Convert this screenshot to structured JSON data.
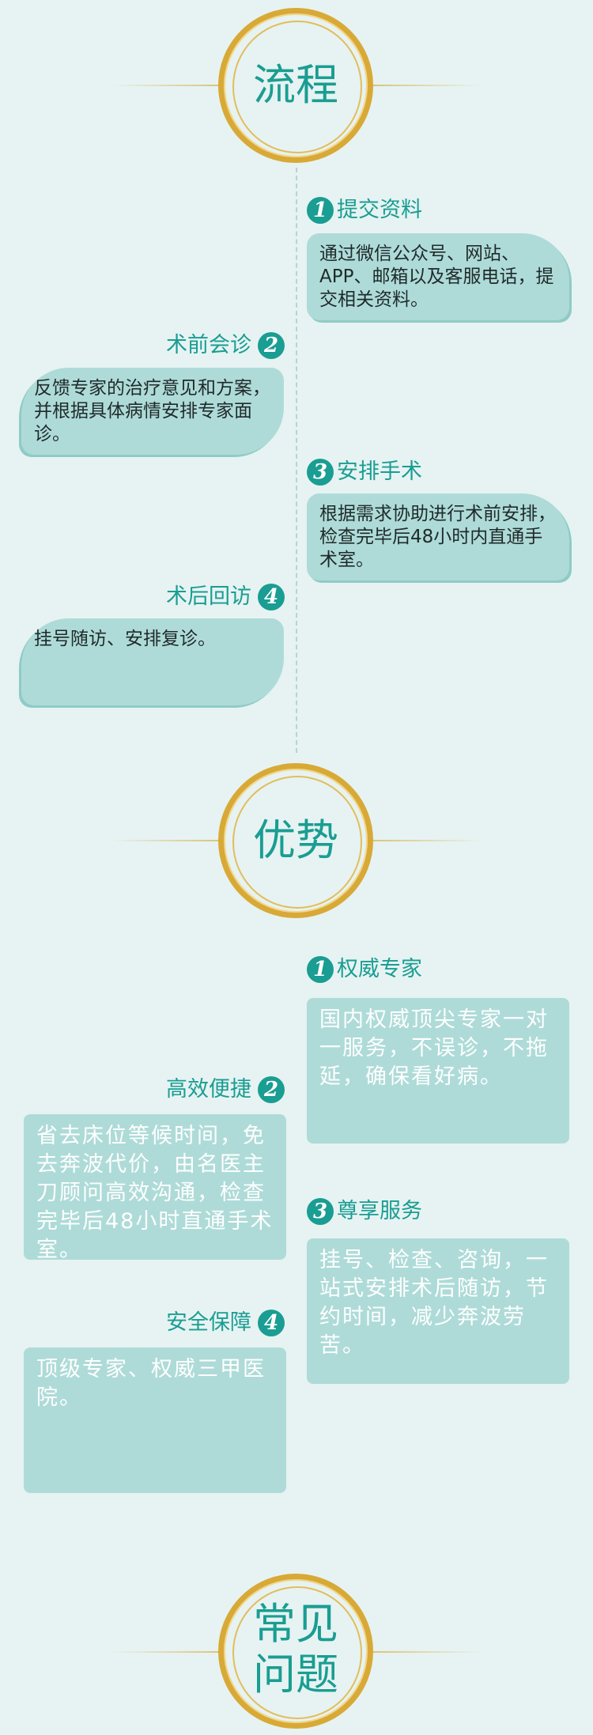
{
  "sections": {
    "process": {
      "title": "流程",
      "steps": [
        {
          "num": "1",
          "title": "提交资料",
          "text": "通过微信公众号、网站、APP、邮箱以及客服电话，提交相关资料。"
        },
        {
          "num": "2",
          "title": "术前会诊",
          "text": "反馈专家的治疗意见和方案，并根据具体病情安排专家面诊。"
        },
        {
          "num": "3",
          "title": "安排手术",
          "text": "根据需求协助进行术前安排，检查完毕后48小时内直通手术室。"
        },
        {
          "num": "4",
          "title": "术后回访",
          "text": "挂号随访、安排复诊。"
        }
      ]
    },
    "advantages": {
      "title": "优势",
      "items": [
        {
          "num": "1",
          "title": "权威专家",
          "text": "国内权威顶尖专家一对一服务，不误诊，不拖延，确保看好病。"
        },
        {
          "num": "2",
          "title": "高效便捷",
          "text": "省去床位等候时间，免去奔波代价，由名医主刀顾问高效沟通，检查完毕后48小时直通手术室。"
        },
        {
          "num": "3",
          "title": "尊享服务",
          "text": "挂号、检查、咨询，一站式安排术后随访，节约时间，减少奔波劳苦。"
        },
        {
          "num": "4",
          "title": "安全保障",
          "text": "顶级专家、权威三甲医院。"
        }
      ]
    },
    "faq": {
      "title_line1": "常见",
      "title_line2": "问题"
    }
  },
  "colors": {
    "background": "#e6f3f2",
    "accent_teal": "#1a9d92",
    "box_fill": "#aedbd8",
    "gold_ring": "#d8a936"
  }
}
